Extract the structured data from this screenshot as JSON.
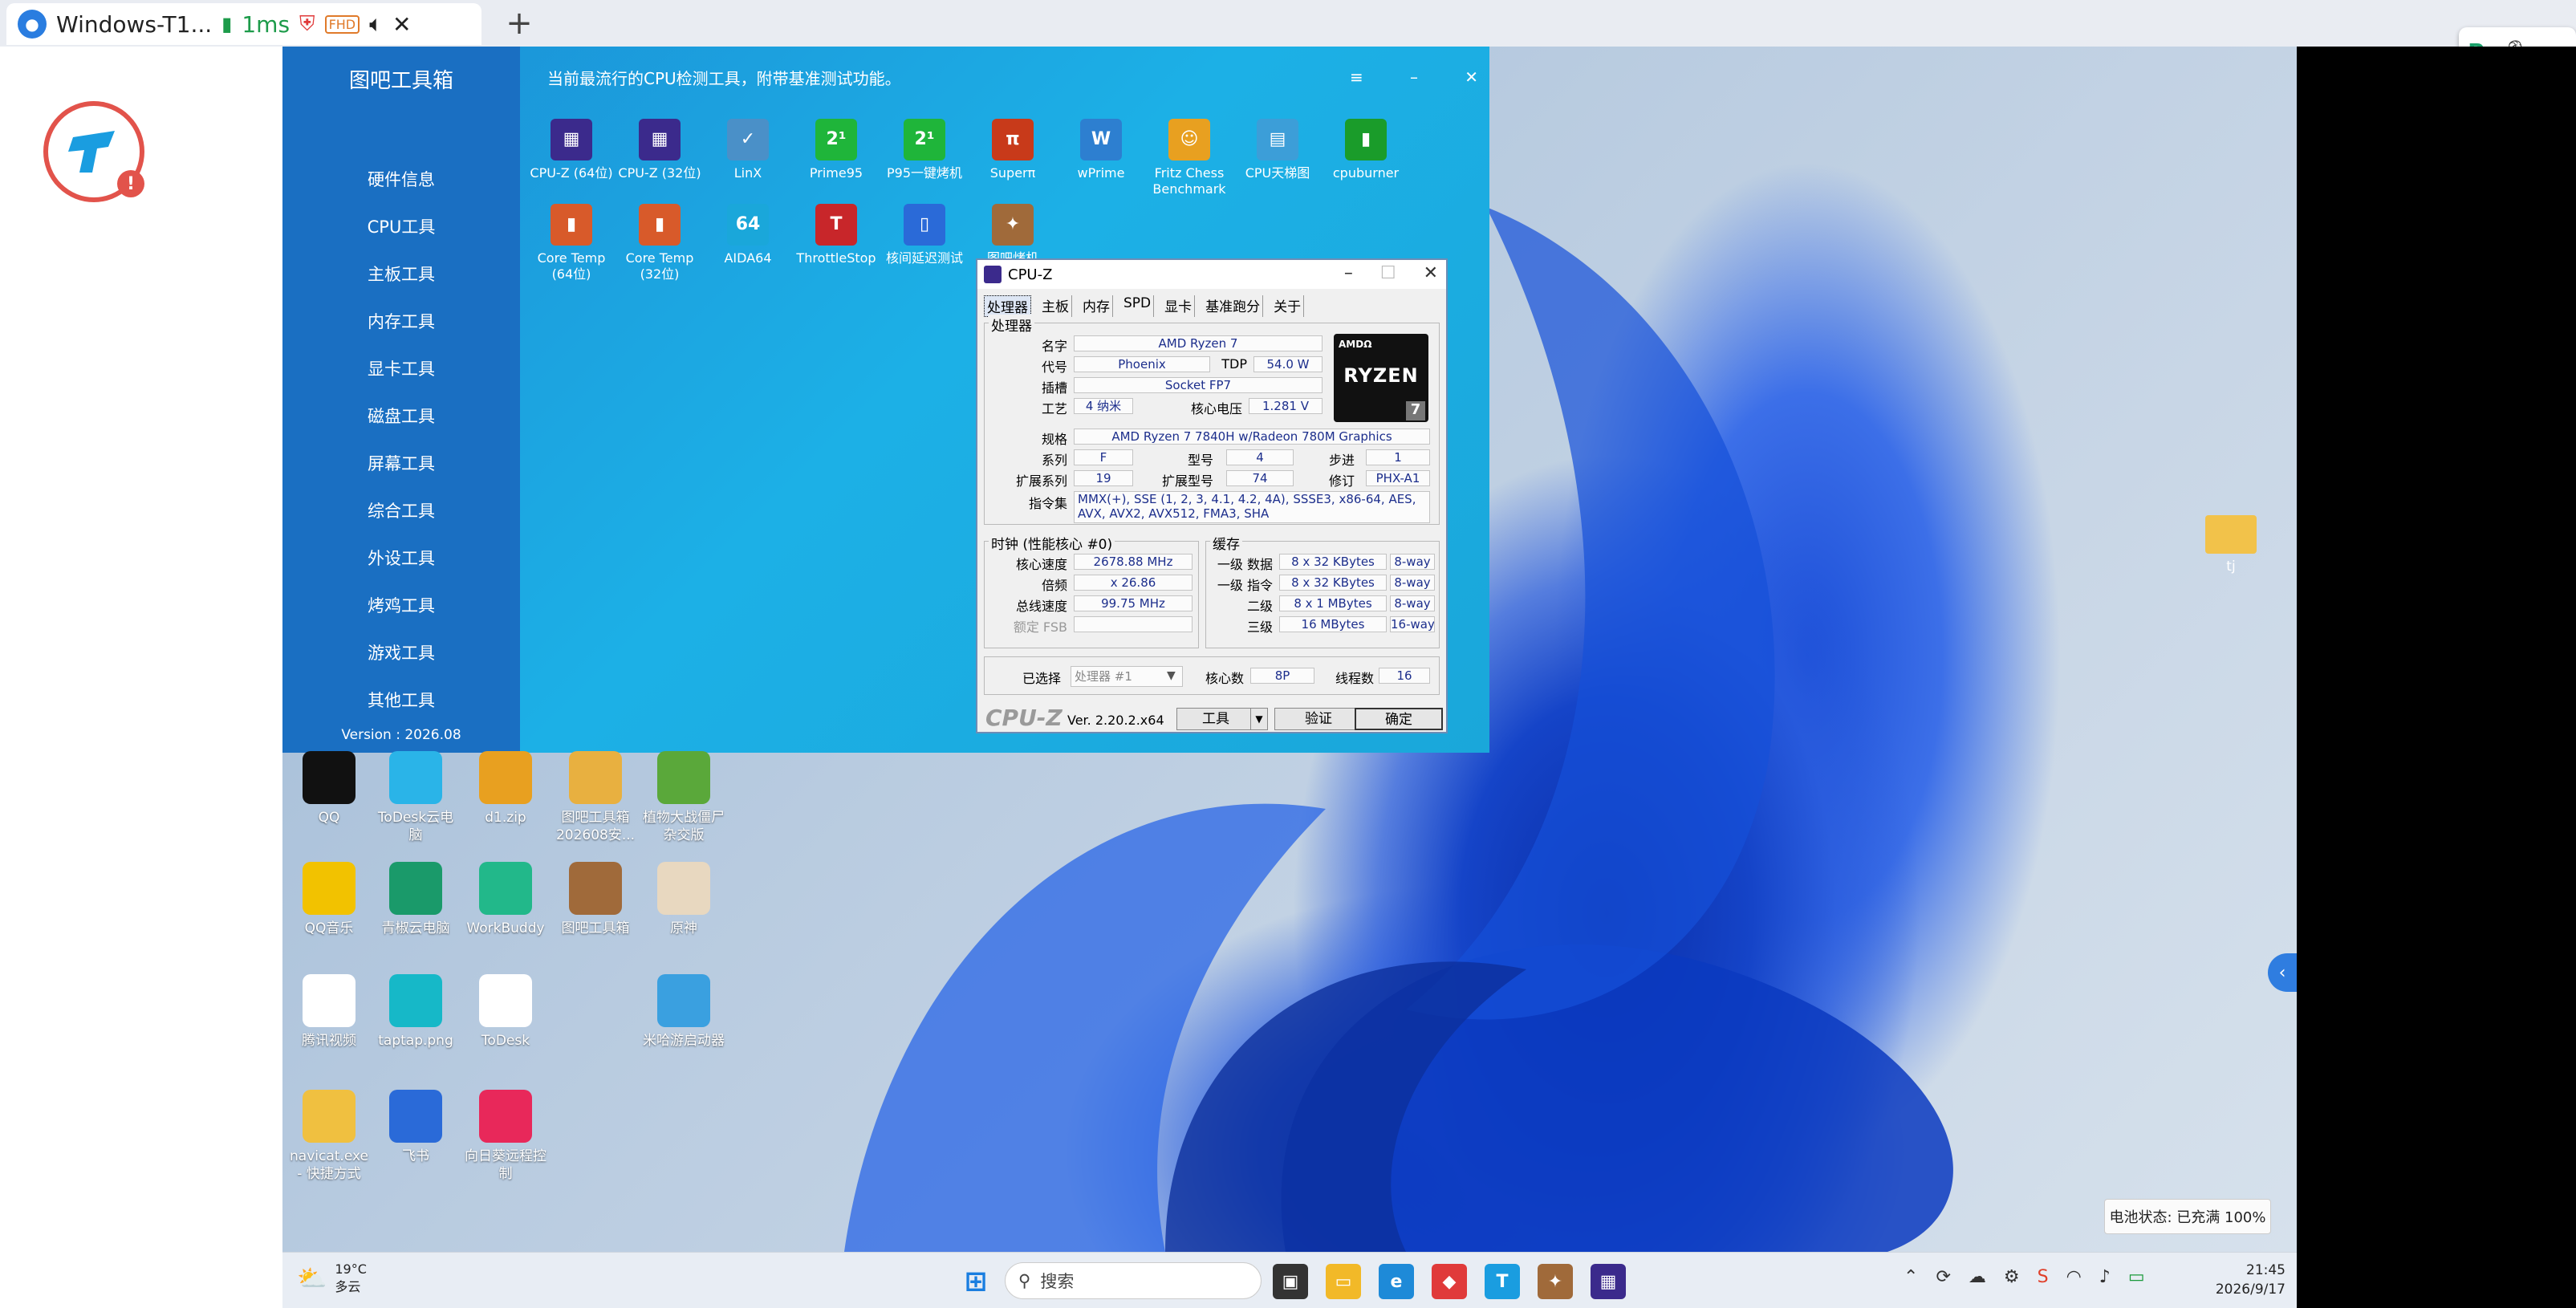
{
  "client": {
    "tab_title": "Windows-T1...",
    "latency": "1ms",
    "hd_badge": "FHD"
  },
  "tool_window": {
    "app_title": "图吧工具箱",
    "description": "当前最流行的CPU检测工具，附带基准测试功能。",
    "version": "Version : 2026.08",
    "sidebar": [
      "硬件信息",
      "CPU工具",
      "主板工具",
      "内存工具",
      "显卡工具",
      "磁盘工具",
      "屏幕工具",
      "综合工具",
      "外设工具",
      "烤鸡工具",
      "游戏工具",
      "其他工具"
    ],
    "tools_row1": [
      {
        "label": "CPU-Z (64位)",
        "color": "#3b2a8c",
        "glyph": "▦"
      },
      {
        "label": "CPU-Z (32位)",
        "color": "#3b2a8c",
        "glyph": "▦"
      },
      {
        "label": "LinX",
        "color": "#4a90c8",
        "glyph": "✓"
      },
      {
        "label": "Prime95",
        "color": "#1fb53a",
        "glyph": "2¹"
      },
      {
        "label": "P95一键烤机",
        "color": "#1fb53a",
        "glyph": "2¹"
      },
      {
        "label": "Superπ",
        "color": "#c83a1a",
        "glyph": "π"
      },
      {
        "label": "wPrime",
        "color": "#2d7fd0",
        "glyph": "W"
      },
      {
        "label": "Fritz Chess Benchmark",
        "color": "#e8a020",
        "glyph": "☺"
      },
      {
        "label": "CPU天梯图",
        "color": "#3c9ed8",
        "glyph": "▤"
      },
      {
        "label": "cpuburner",
        "color": "#1a9c2a",
        "glyph": "▮"
      }
    ],
    "tools_row2": [
      {
        "label": "Core Temp (64位)",
        "color": "#d85a2a",
        "glyph": "▮"
      },
      {
        "label": "Core Temp (32位)",
        "color": "#d85a2a",
        "glyph": "▮"
      },
      {
        "label": "AIDA64",
        "color": "#1aa7da",
        "glyph": "64"
      },
      {
        "label": "ThrottleStop",
        "color": "#c8262a",
        "glyph": "T"
      },
      {
        "label": "核间延迟测试",
        "color": "#2a6ad8",
        "glyph": "▯"
      },
      {
        "label": "图吧烤机",
        "color": "#a06a3a",
        "glyph": "✦"
      }
    ]
  },
  "cpuz": {
    "title": "CPU-Z",
    "tabs": [
      "处理器",
      "主板",
      "内存",
      "SPD",
      "显卡",
      "基准跑分",
      "关于"
    ],
    "processor_group": "处理器",
    "labels": {
      "name": "名字",
      "codename": "代号",
      "package": "插槽",
      "tech": "工艺",
      "spec": "规格",
      "family": "系列",
      "ext_family": "扩展系列",
      "instructions": "指令集",
      "tdp": "TDP",
      "voltage": "核心电压",
      "model": "型号",
      "ext_model": "扩展型号",
      "stepping": "步进",
      "revision": "修订"
    },
    "name": "AMD Ryzen 7",
    "codename": "Phoenix",
    "tdp": "54.0 W",
    "package": "Socket FP7",
    "tech": "4 纳米",
    "voltage": "1.281 V",
    "spec": "AMD Ryzen 7 7840H w/Radeon 780M Graphics",
    "family": "F",
    "model": "4",
    "stepping": "1",
    "ext_family": "19",
    "ext_model": "74",
    "revision": "PHX-A1",
    "instructions_l1": "MMX(+), SSE (1, 2, 3, 4.1, 4.2, 4A), SSSE3, x86-64, AES,",
    "instructions_l2": "AVX, AVX2, AVX512, FMA3, SHA",
    "logo": {
      "brand": "AMDΩ",
      "name": "RYZEN",
      "num": "7"
    },
    "clocks_group": "时钟 (性能核心 #0)",
    "clock_labels": [
      "核心速度",
      "倍频",
      "总线速度",
      "额定 FSB"
    ],
    "core_speed": "2678.88 MHz",
    "multiplier": "x 26.86",
    "bus_speed": "99.75 MHz",
    "cache_group": "缓存",
    "cache_labels": [
      "一级 数据",
      "一级 指令",
      "二级",
      "三级"
    ],
    "cache": [
      {
        "size": "8 x 32 KBytes",
        "way": "8-way"
      },
      {
        "size": "8 x 32 KBytes",
        "way": "8-way"
      },
      {
        "size": "8 x 1 MBytes",
        "way": "8-way"
      },
      {
        "size": "16 MBytes",
        "way": "16-way"
      }
    ],
    "selected_label": "已选择",
    "selected": "处理器 #1",
    "cores_label": "核心数",
    "cores": "8P",
    "threads_label": "线程数",
    "threads": "16",
    "brand": "CPU-Z",
    "version": "Ver. 2.20.2.x64",
    "btn_tools": "工具",
    "btn_validate": "验证",
    "btn_ok": "确定"
  },
  "desktop_icons": [
    {
      "label": "QQ",
      "color": "#111"
    },
    {
      "label": "ToDesk云电脑",
      "color": "#2ab4e8"
    },
    {
      "label": "d1.zip",
      "color": "#e8a020"
    },
    {
      "label": "图吧工具箱 202608安...",
      "color": "#e8b040"
    },
    {
      "label": "植物大战僵尸杂交版",
      "color": "#5aa83a"
    },
    {
      "label": "QQ音乐",
      "color": "#f2c200"
    },
    {
      "label": "青椒云电脑",
      "color": "#1a9a6a"
    },
    {
      "label": "WorkBuddy",
      "color": "#22b88a"
    },
    {
      "label": "图吧工具箱",
      "color": "#a06a3a"
    },
    {
      "label": "原神",
      "color": "#e8d8c0"
    },
    {
      "label": "腾讯视频",
      "color": "#ffffff"
    },
    {
      "label": "taptap.png",
      "color": "#16b8c8"
    },
    {
      "label": "ToDesk",
      "color": "#ffffff"
    },
    {
      "label": "米哈游启动器",
      "color": "#3aa0e0"
    },
    {
      "label": "navicat.exe - 快捷方式",
      "color": "#f0c040"
    },
    {
      "label": "飞书",
      "color": "#2a6ad8"
    },
    {
      "label": "向日葵远程控制",
      "color": "#e8285a"
    }
  ],
  "desktop_folder": "tj",
  "battery_status": "电池状态: 已充满 100%",
  "taskbar": {
    "temp": "19°C",
    "weather": "多云",
    "search_placeholder": "搜索",
    "time": "21:45",
    "date": "2026/9/17"
  }
}
